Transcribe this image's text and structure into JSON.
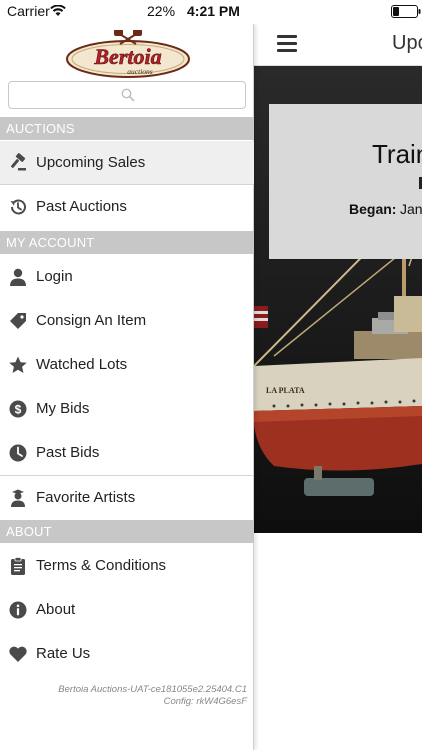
{
  "status_bar": {
    "carrier": "Carrier",
    "battery_percent": "22%",
    "time": "4:21 PM"
  },
  "main": {
    "title": "Upco",
    "card": {
      "title": "Train",
      "began_label": "Began:",
      "began_value": "Jan"
    }
  },
  "drawer": {
    "logo_text": "Bertoia",
    "logo_subtext": "auctions",
    "search": {
      "placeholder": ""
    },
    "sections": [
      {
        "header": "AUCTIONS",
        "items": [
          {
            "label": "Upcoming Sales",
            "icon": "gavel-icon",
            "active": true
          },
          {
            "label": "Past Auctions",
            "icon": "history-icon",
            "active": false
          }
        ]
      },
      {
        "header": "MY ACCOUNT",
        "items": [
          {
            "label": "Login",
            "icon": "user-icon"
          },
          {
            "label": "Consign An Item",
            "icon": "tag-icon"
          },
          {
            "label": "Watched Lots",
            "icon": "star-icon"
          },
          {
            "label": "My Bids",
            "icon": "dollar-icon"
          },
          {
            "label": "Past Bids",
            "icon": "clock-icon"
          },
          {
            "label": "Favorite Artists",
            "icon": "artist-icon"
          }
        ]
      },
      {
        "header": "ABOUT",
        "items": [
          {
            "label": "Terms & Conditions",
            "icon": "clipboard-icon"
          },
          {
            "label": "About",
            "icon": "info-icon"
          },
          {
            "label": "Rate Us",
            "icon": "heart-icon"
          }
        ]
      }
    ],
    "version_line1": "Bertoia Auctions-UAT-ce181055e2.25404.C1",
    "version_line2": "Config: rkW4G6esF"
  },
  "colors": {
    "section_header_bg": "#c7c7c7",
    "active_item_bg": "#efefef",
    "logo_red": "#b3202a",
    "icon_gray": "#4a4a4a"
  }
}
